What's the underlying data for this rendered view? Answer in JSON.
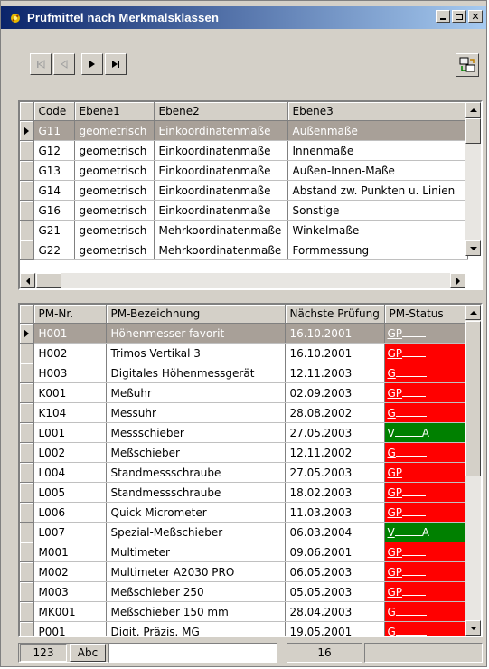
{
  "window": {
    "title": "Prüfmittel nach Merkmalsklassen"
  },
  "colors": {
    "title_from": "#0a246a",
    "title_to": "#a6caf0",
    "status_red": "#ff0000",
    "status_green": "#008000",
    "selected_row": "#a8a098"
  },
  "toolbar": {
    "nav_first": "first-record-icon",
    "nav_prev": "previous-record-icon",
    "nav_next": "next-record-icon",
    "nav_last": "last-record-icon",
    "action_icon": "transfer-records-icon"
  },
  "classes_grid": {
    "columns": [
      "Code",
      "Ebene1",
      "Ebene2",
      "Ebene3"
    ],
    "rows": [
      {
        "code": "G11",
        "ebene1": "geometrisch",
        "ebene2": "Einkoordinatenmaße",
        "ebene3": "Außenmaße",
        "selected": true
      },
      {
        "code": "G12",
        "ebene1": "geometrisch",
        "ebene2": "Einkoordinatenmaße",
        "ebene3": "Innenmaße"
      },
      {
        "code": "G13",
        "ebene1": "geometrisch",
        "ebene2": "Einkoordinatenmaße",
        "ebene3": "Außen-Innen-Maße"
      },
      {
        "code": "G14",
        "ebene1": "geometrisch",
        "ebene2": "Einkoordinatenmaße",
        "ebene3": "Abstand zw. Punkten u. Linien"
      },
      {
        "code": "G16",
        "ebene1": "geometrisch",
        "ebene2": "Einkoordinatenmaße",
        "ebene3": "Sonstige"
      },
      {
        "code": "G21",
        "ebene1": "geometrisch",
        "ebene2": "Mehrkoordinatenmaße",
        "ebene3": "Winkelmaße"
      },
      {
        "code": "G22",
        "ebene1": "geometrisch",
        "ebene2": "Mehrkoordinatenmaße",
        "ebene3": "Formmessung"
      }
    ]
  },
  "instruments_grid": {
    "columns": [
      "PM-Nr.",
      "PM-Bezeichnung",
      "Nächste Prüfung",
      "PM-Status"
    ],
    "rows": [
      {
        "nr": "H001",
        "bezeichnung": "Höhenmesser favorit",
        "pruefung": "16.10.2001",
        "status": "GP",
        "color": "red",
        "selected": true
      },
      {
        "nr": "H002",
        "bezeichnung": "Trimos Vertikal 3",
        "pruefung": "16.10.2001",
        "status": "GP",
        "color": "red"
      },
      {
        "nr": "H003",
        "bezeichnung": "Digitales Höhenmessgerät",
        "pruefung": "12.11.2003",
        "status": "G",
        "color": "red"
      },
      {
        "nr": "K001",
        "bezeichnung": "Meßuhr",
        "pruefung": "02.09.2003",
        "status": "GP",
        "color": "red"
      },
      {
        "nr": "K104",
        "bezeichnung": "Messuhr",
        "pruefung": "28.08.2002",
        "status": "G",
        "color": "red"
      },
      {
        "nr": "L001",
        "bezeichnung": "Messschieber",
        "pruefung": "27.05.2003",
        "status": "V",
        "status2": "A",
        "color": "green"
      },
      {
        "nr": "L002",
        "bezeichnung": "Meßschieber",
        "pruefung": "12.11.2002",
        "status": "G",
        "color": "red"
      },
      {
        "nr": "L004",
        "bezeichnung": "Standmessschraube",
        "pruefung": "27.05.2003",
        "status": "GP",
        "color": "red"
      },
      {
        "nr": "L005",
        "bezeichnung": "Standmessschraube",
        "pruefung": "18.02.2003",
        "status": "GP",
        "color": "red"
      },
      {
        "nr": "L006",
        "bezeichnung": "Quick Micrometer",
        "pruefung": "11.03.2003",
        "status": "GP",
        "color": "red"
      },
      {
        "nr": "L007",
        "bezeichnung": "Spezial-Meßschieber",
        "pruefung": "06.03.2004",
        "status": "V",
        "status2": "A",
        "color": "green"
      },
      {
        "nr": "M001",
        "bezeichnung": "Multimeter",
        "pruefung": "09.06.2001",
        "status": "GP",
        "color": "red"
      },
      {
        "nr": "M002",
        "bezeichnung": "Multimeter A2030 PRO",
        "pruefung": "06.05.2003",
        "status": "GP",
        "color": "red"
      },
      {
        "nr": "M003",
        "bezeichnung": "Meßschieber 250",
        "pruefung": "05.05.2003",
        "status": "GP",
        "color": "red"
      },
      {
        "nr": "MK001",
        "bezeichnung": "Meßschieber 150 mm",
        "pruefung": "28.04.2003",
        "status": "G",
        "color": "red"
      },
      {
        "nr": "P001",
        "bezeichnung": "Digit. Präzis. MG",
        "pruefung": "19.05.2001",
        "status": "G",
        "color": "red"
      }
    ]
  },
  "statusbar": {
    "tab_num": "123",
    "tab_abc": "Abc",
    "search_value": "",
    "count": "16"
  }
}
